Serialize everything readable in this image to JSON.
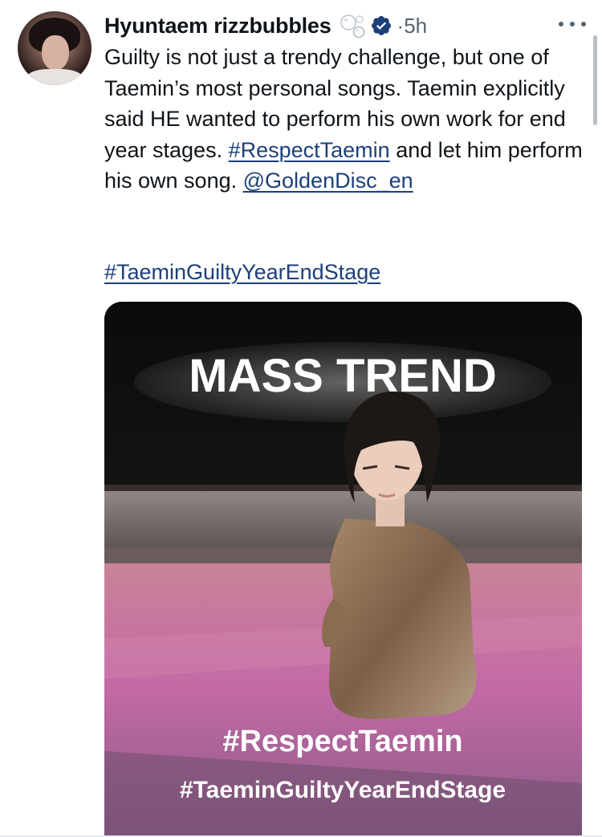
{
  "post": {
    "author_name": "Hyuntaem rizzbubbles",
    "separator": "·",
    "time": "5h",
    "text_parts": [
      "Guilty is not just a trendy challenge, but one of Taemin’s most personal songs. Taemin explicitly said HE wanted to perform his own work for end year stages. ",
      "#RespectTaemin",
      " and let him perform his own song. ",
      "@GoldenDisc_en"
    ],
    "hashtag_line": "#TaeminGuiltyYearEndStage",
    "icons": {
      "author_badge": "bubbles-icon",
      "verified": "verified-badge-icon",
      "more": "more-options-icon"
    },
    "colors": {
      "link": "#1d3f7a",
      "verified": "#1d3f7a",
      "muted": "#536471"
    }
  },
  "media": {
    "headline": "MASS TREND",
    "tag_line_1": "#RespectTaemin",
    "tag_line_2": "#TaeminGuiltyYearEndStage"
  }
}
